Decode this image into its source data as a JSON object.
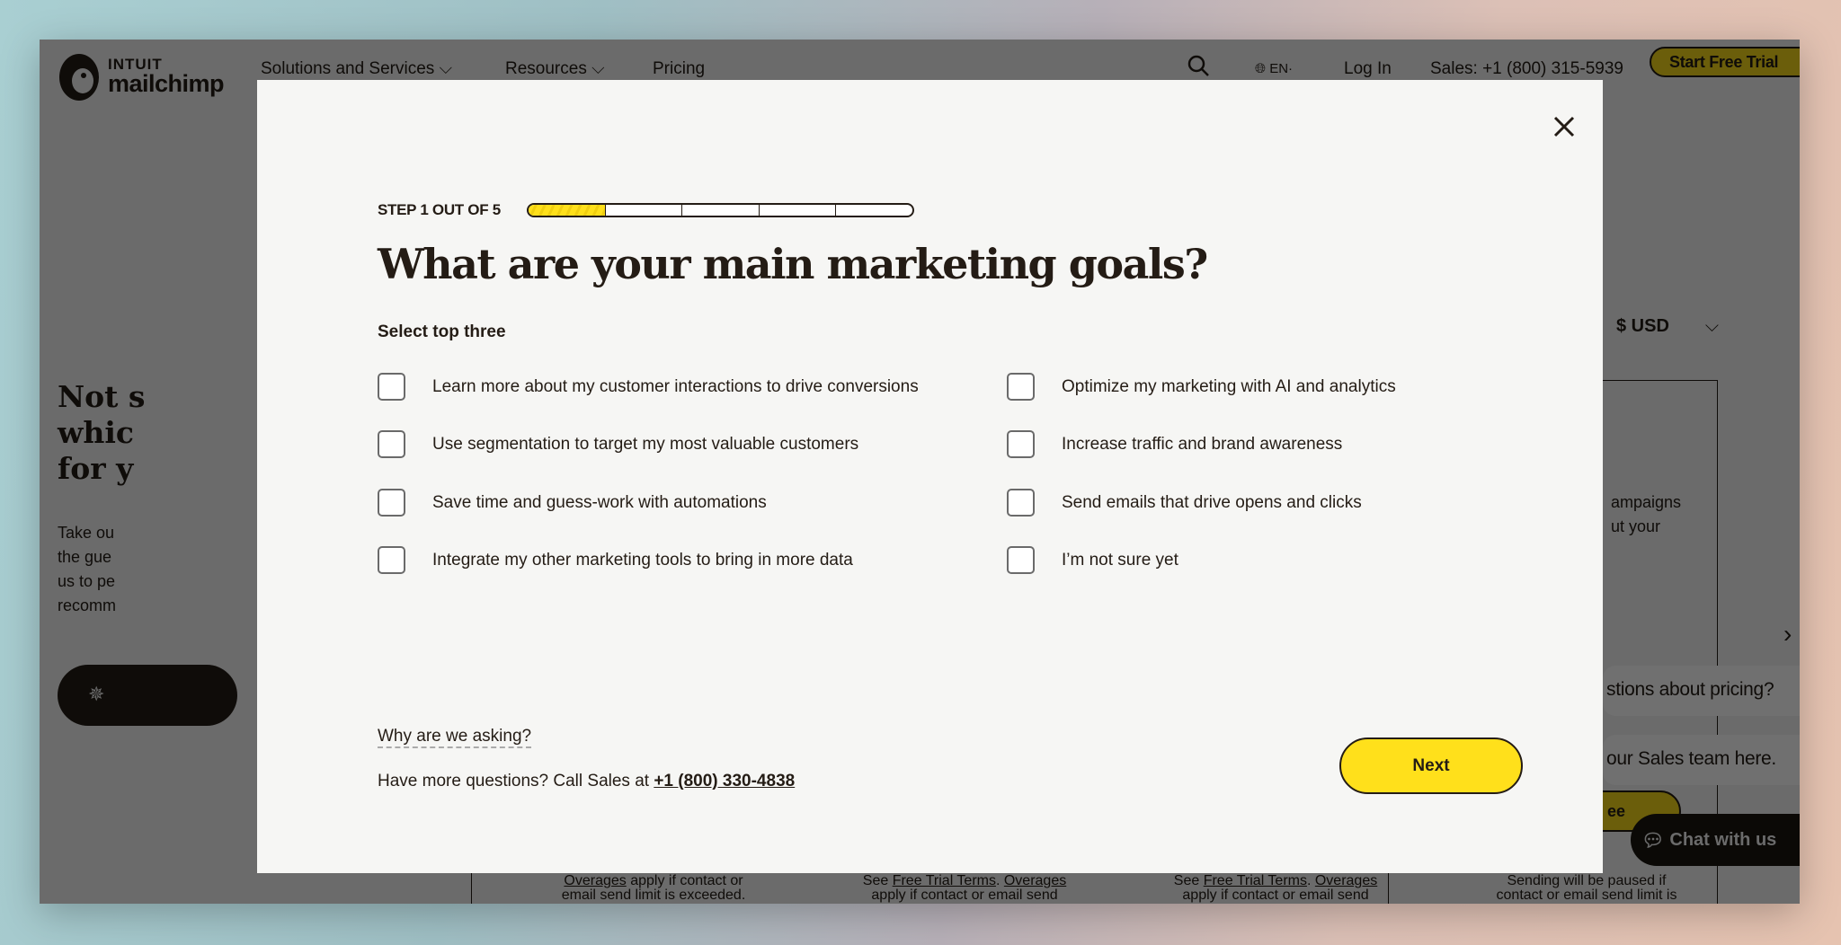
{
  "nav": {
    "logo_top": "INTUIT",
    "logo_bottom": "mailchimp",
    "items": [
      "Solutions and Services",
      "Resources",
      "Pricing"
    ],
    "language": "EN",
    "login": "Log In",
    "sales": "Sales: +1 (800) 315-5939",
    "cta": "Start Free Trial"
  },
  "background": {
    "heading_lines": [
      "Not s",
      "whic",
      "for y"
    ],
    "para_lines": [
      "Take ou",
      "the gue",
      "us to pe",
      "recomm"
    ],
    "currency": "$ USD",
    "card_lines": [
      "ampaigns",
      "ut your"
    ],
    "bubble1": "stions about pricing?",
    "bubble2": "our Sales team here.",
    "btn_frag": "ee",
    "chat": "Chat with us",
    "bottom": [
      {
        "l1a": "Overages",
        "l1b": " apply if contact or",
        "l2": "email send limit is exceeded."
      },
      {
        "l1pre": "See ",
        "l1a": "Free Trial Terms",
        "l1mid": ". ",
        "l1b": "Overages",
        "l2": "apply if contact or email send"
      },
      {
        "l1pre": "See ",
        "l1a": "Free Trial Terms",
        "l1mid": ". ",
        "l1b": "Overages",
        "l2": "apply if contact or email send"
      },
      {
        "l1": "Sending will be paused if",
        "l2": "contact or email send limit is"
      }
    ]
  },
  "modal": {
    "step_label": "STEP 1 OUT OF 5",
    "progress": {
      "current": 1,
      "total": 5,
      "fill_color": "#ffe01b"
    },
    "title": "What are your main marketing goals?",
    "subtitle": "Select top three",
    "options_left": [
      "Learn more about my customer interactions to drive conversions",
      "Use segmentation to target my most valuable customers",
      "Save time and guess-work with automations",
      "Integrate my other marketing tools to bring in more data"
    ],
    "options_right": [
      "Optimize my marketing with AI and analytics",
      "Increase traffic and brand awareness",
      "Send emails that drive opens and clicks",
      "I’m not sure yet"
    ],
    "why_link": "Why are we asking?",
    "call_text": "Have more questions? Call Sales at ",
    "call_phone": "+1 (800) 330-4838",
    "next": "Next"
  }
}
